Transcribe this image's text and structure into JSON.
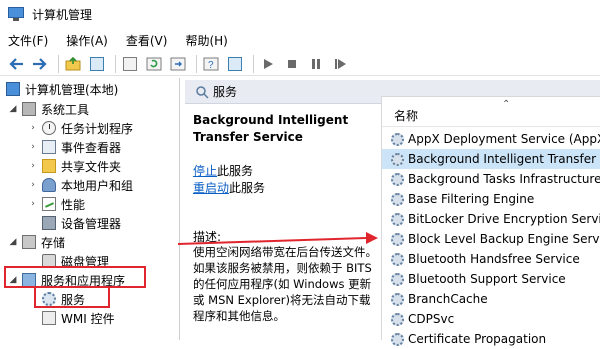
{
  "window": {
    "title": "计算机管理"
  },
  "menu": [
    "文件(F)",
    "操作(A)",
    "查看(V)",
    "帮助(H)"
  ],
  "toolbar": {
    "icons": [
      "back-icon",
      "forward-icon",
      "up-folder-icon",
      "show-hide-tree-icon",
      "properties-icon",
      "refresh-icon",
      "export-icon",
      "help-icon",
      "view-icon",
      "start-icon",
      "stop-icon",
      "pause-icon",
      "restart-icon"
    ]
  },
  "tree": {
    "root": "计算机管理(本地)",
    "system_tools": "系统工具",
    "task_scheduler": "任务计划程序",
    "event_viewer": "事件查看器",
    "shared_folders": "共享文件夹",
    "local_users": "本地用户和组",
    "performance": "性能",
    "device_manager": "设备管理器",
    "storage": "存储",
    "disk_management": "磁盘管理",
    "services_apps": "服务和应用程序",
    "services": "服务",
    "wmi": "WMI 控件"
  },
  "right": {
    "header": "服务",
    "service_name": "Background Intelligent Transfer Service",
    "actions": [
      {
        "link": "停止",
        "suffix": "此服务"
      },
      {
        "link": "重启动",
        "suffix": "此服务"
      }
    ],
    "desc_label": "描述:",
    "description": "使用空闲网络带宽在后台传送文件。如果该服务被禁用，则依赖于 BITS 的任何应用程序(如 Windows 更新或 MSN Explorer)将无法自动下载程序和其他信息。",
    "column_name": "名称",
    "services": [
      "AppX Deployment Service (AppXSVC)",
      "Background Intelligent Transfer Service",
      "Background Tasks Infrastructure Service",
      "Base Filtering Engine",
      "BitLocker Drive Encryption Service",
      "Block Level Backup Engine Service",
      "Bluetooth Handsfree Service",
      "Bluetooth Support Service",
      "BranchCache",
      "CDPSvc",
      "Certificate Propagation"
    ],
    "selected_index": 1
  },
  "colors": {
    "annotation": "#e0252d",
    "selection": "#cce4f7",
    "link": "#0b5fc6"
  }
}
